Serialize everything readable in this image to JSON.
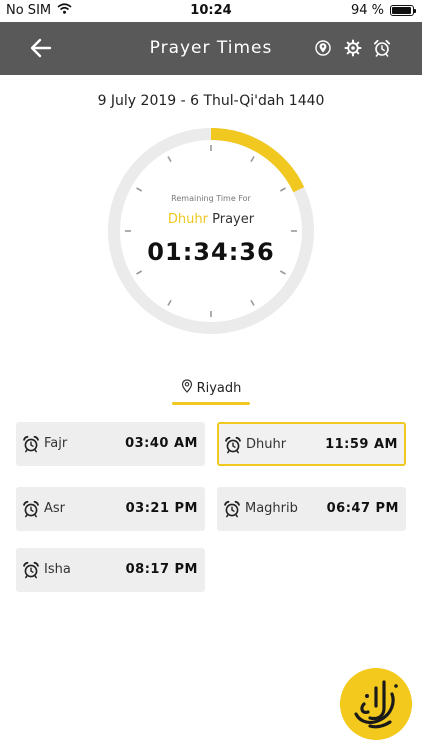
{
  "status_bar": {
    "carrier": "No SIM",
    "time": "10:24",
    "battery": "94 %",
    "battery_level": 0.94
  },
  "nav": {
    "title": "Prayer Times",
    "back_icon": "arrow-left-icon",
    "icons": [
      "location-icon",
      "settings-icon",
      "alarm-icon"
    ]
  },
  "date": "9 July 2019 - 6 Thul-Qi'dah 1440",
  "countdown": {
    "label": "Remaining Time For",
    "prayer": "Dhuhr",
    "prayer_suffix": "Prayer",
    "time": "01:34:36",
    "progress": 0.18
  },
  "location": {
    "city": "Riyadh"
  },
  "prayers": [
    {
      "name": "Fajr",
      "time": "03:40 AM",
      "active": false
    },
    {
      "name": "Dhuhr",
      "time": "11:59 AM",
      "active": true
    },
    {
      "name": "Asr",
      "time": "03:21 PM",
      "active": false
    },
    {
      "name": "Maghrib",
      "time": "06:47 PM",
      "active": false
    },
    {
      "name": "Isha",
      "time": "08:17 PM",
      "active": false
    }
  ],
  "colors": {
    "accent": "#f0c81f",
    "nav_bg": "#595959",
    "card_bg": "#eeeeee",
    "ring_track": "#ebebeb"
  }
}
